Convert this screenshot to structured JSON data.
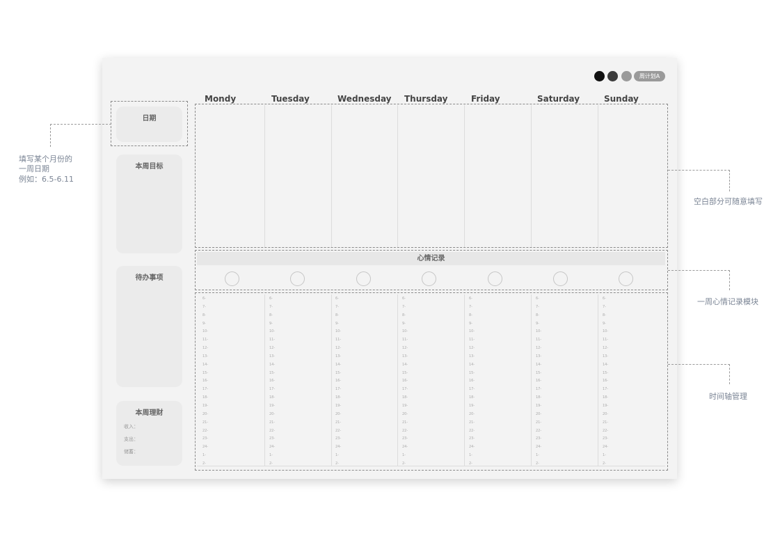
{
  "header": {
    "dot_colors": [
      "#111111",
      "#3c3c3c",
      "#9a9a9a"
    ],
    "badge_label": "周计划A"
  },
  "left_panels": {
    "date_title": "日期",
    "goal_title": "本周目标",
    "todo_title": "待办事项",
    "finance_title": "本周理财",
    "finance_income": "收入：",
    "finance_expense": "支出：",
    "finance_savings": "储蓄："
  },
  "days": [
    "Mondy",
    "Tuesday",
    "Wednesday",
    "Thursday",
    "Friday",
    "Saturday",
    "Sunday"
  ],
  "mood_title": "心情记录",
  "timeline_hours": [
    "6-",
    "7-",
    "8-",
    "9-",
    "10-",
    "11-",
    "12-",
    "13-",
    "14-",
    "15-",
    "16-",
    "17-",
    "18-",
    "19-",
    "20-",
    "21-",
    "22-",
    "23-",
    "24-",
    "1-",
    "2-"
  ],
  "annotations": {
    "date_note_line1": "填写某个月份的",
    "date_note_line2": "一周日期",
    "date_note_line3": "例如：6.5-6.11",
    "blank_note": "空白部分可随意填写",
    "mood_note": "一周心情记录模块",
    "timeline_note": "时间轴管理"
  }
}
